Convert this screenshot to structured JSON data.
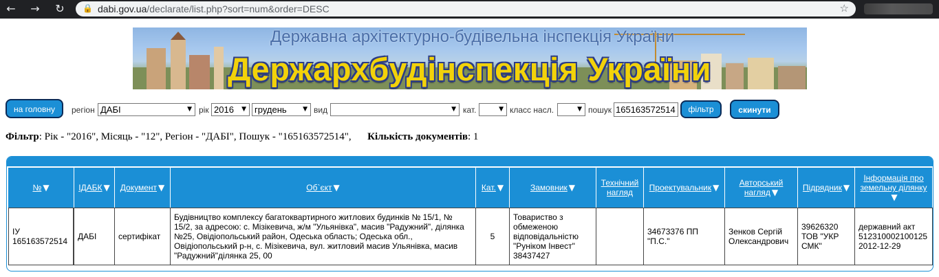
{
  "browser": {
    "back_glyph": "←",
    "forward_glyph": "→",
    "reload_glyph": "↻",
    "url_host": "dabi.gov.ua",
    "url_path": "/declarate/list.php?sort=num&order=DESC",
    "lock_glyph": "🔒",
    "star_glyph": "☆"
  },
  "banner": {
    "subtitle": "Державна архітектурно-будівельна інспекція України",
    "title": "Держархбудінспекція України"
  },
  "filters": {
    "home_button": "на головну",
    "region_label": "регіон",
    "region_value": "ДАБІ",
    "year_label": "рік",
    "year_value": "2016",
    "month_value": "грудень",
    "type_label": "вид",
    "type_value": "",
    "category_label": "кат.",
    "category_value": "",
    "class_label": "класс насл.",
    "class_value": "",
    "search_label": "пошук",
    "search_value": "165163572514",
    "filter_button": "фільтр",
    "reset_button": "скинути",
    "arrow": "▼"
  },
  "summary": {
    "filter_label": "Фільтр",
    "filter_text": ": Рік - \"2016\", Місяць - \"12\", Регіон - \"ДАБІ\", Пошук - \"165163572514\",",
    "count_label": "Кількість документів",
    "count_value": ": 1"
  },
  "table": {
    "sort_glyph": "▼",
    "headers": {
      "num": "№",
      "idabk": "ІДАБК",
      "document": "Документ",
      "object": "Об`єкт",
      "category": "Кат.",
      "customer": "Замовник",
      "tech_line1": "Технічний",
      "tech_line2": "нагляд",
      "designer": "Проектувальник",
      "author_line1": "Авторський",
      "author_line2": "нагляд",
      "contractor": "Підрядник",
      "land_line1": "Інформація про",
      "land_line2": "земельну ділянку"
    },
    "row": {
      "num": "ІУ 165163572514",
      "idabk": "ДАБІ",
      "document": "сертифікат",
      "object": "Будівництво комплексу багатоквартирного житлових будинків № 15/1, № 15/2, за адресою: с. Мізікевича, ж/м \"Ульянівка\", масив \"Радужний\", ділянка №25, Овідіопольський район, Одеська область; Одеська обл., Овідіопольський р-н, с. Мізікевича, вул. житловий масив Ульянівка, масив \"Радужний\"ділянка 25, 00",
      "category": "5",
      "customer": "Товариство з обмеженою відповідальністю \"Руніком Інвест\" 38437427",
      "tech": "",
      "designer": "34673376 ПП \"П.С.\"",
      "author": "Зенков Сергій Олександрович",
      "contractor": "39626320 ТОВ \"УКР СМК\"",
      "land": "державний акт 512310002100125 2012-12-29"
    }
  }
}
